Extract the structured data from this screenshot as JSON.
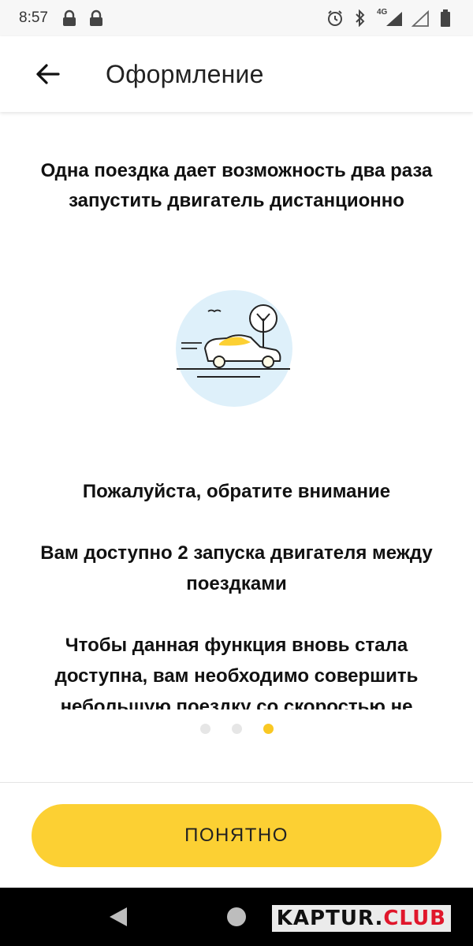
{
  "status_bar": {
    "time": "8:57",
    "network": "4G",
    "left_icons": [
      "lock-icon",
      "lock-icon"
    ],
    "right_icons": [
      "alarm-icon",
      "bluetooth-icon",
      "signal-icon",
      "signal-empty-icon",
      "battery-icon"
    ]
  },
  "app_bar": {
    "back_icon": "arrow-left-icon",
    "title": "Оформление"
  },
  "content": {
    "headline": "Одна поездка дает возможность два раза запустить двигатель дистанционно",
    "illustration": "car-tree-illustration",
    "notice": {
      "title": "Пожалуйста, обратите внимание",
      "line1": "Вам доступно 2 запуска двигателя между поездками",
      "line2": "Чтобы данная функция вновь стала доступна, вам необходимо совершить небольшую поездку со скоростью не"
    },
    "pagination": {
      "total": 3,
      "active_index": 2
    }
  },
  "actions": {
    "confirm_label": "ПОНЯТНО"
  },
  "nav_bar": {
    "icons": [
      "back-triangle-icon",
      "home-circle-icon"
    ]
  },
  "watermark": {
    "part1": "KAPTUR.",
    "part2": "CLUB"
  },
  "colors": {
    "accent": "#fcd033",
    "dot_active": "#f9c823",
    "dot_inactive": "#e6e6e6",
    "illustration_bg": "#def0fa",
    "watermark_red": "#e0162b"
  }
}
